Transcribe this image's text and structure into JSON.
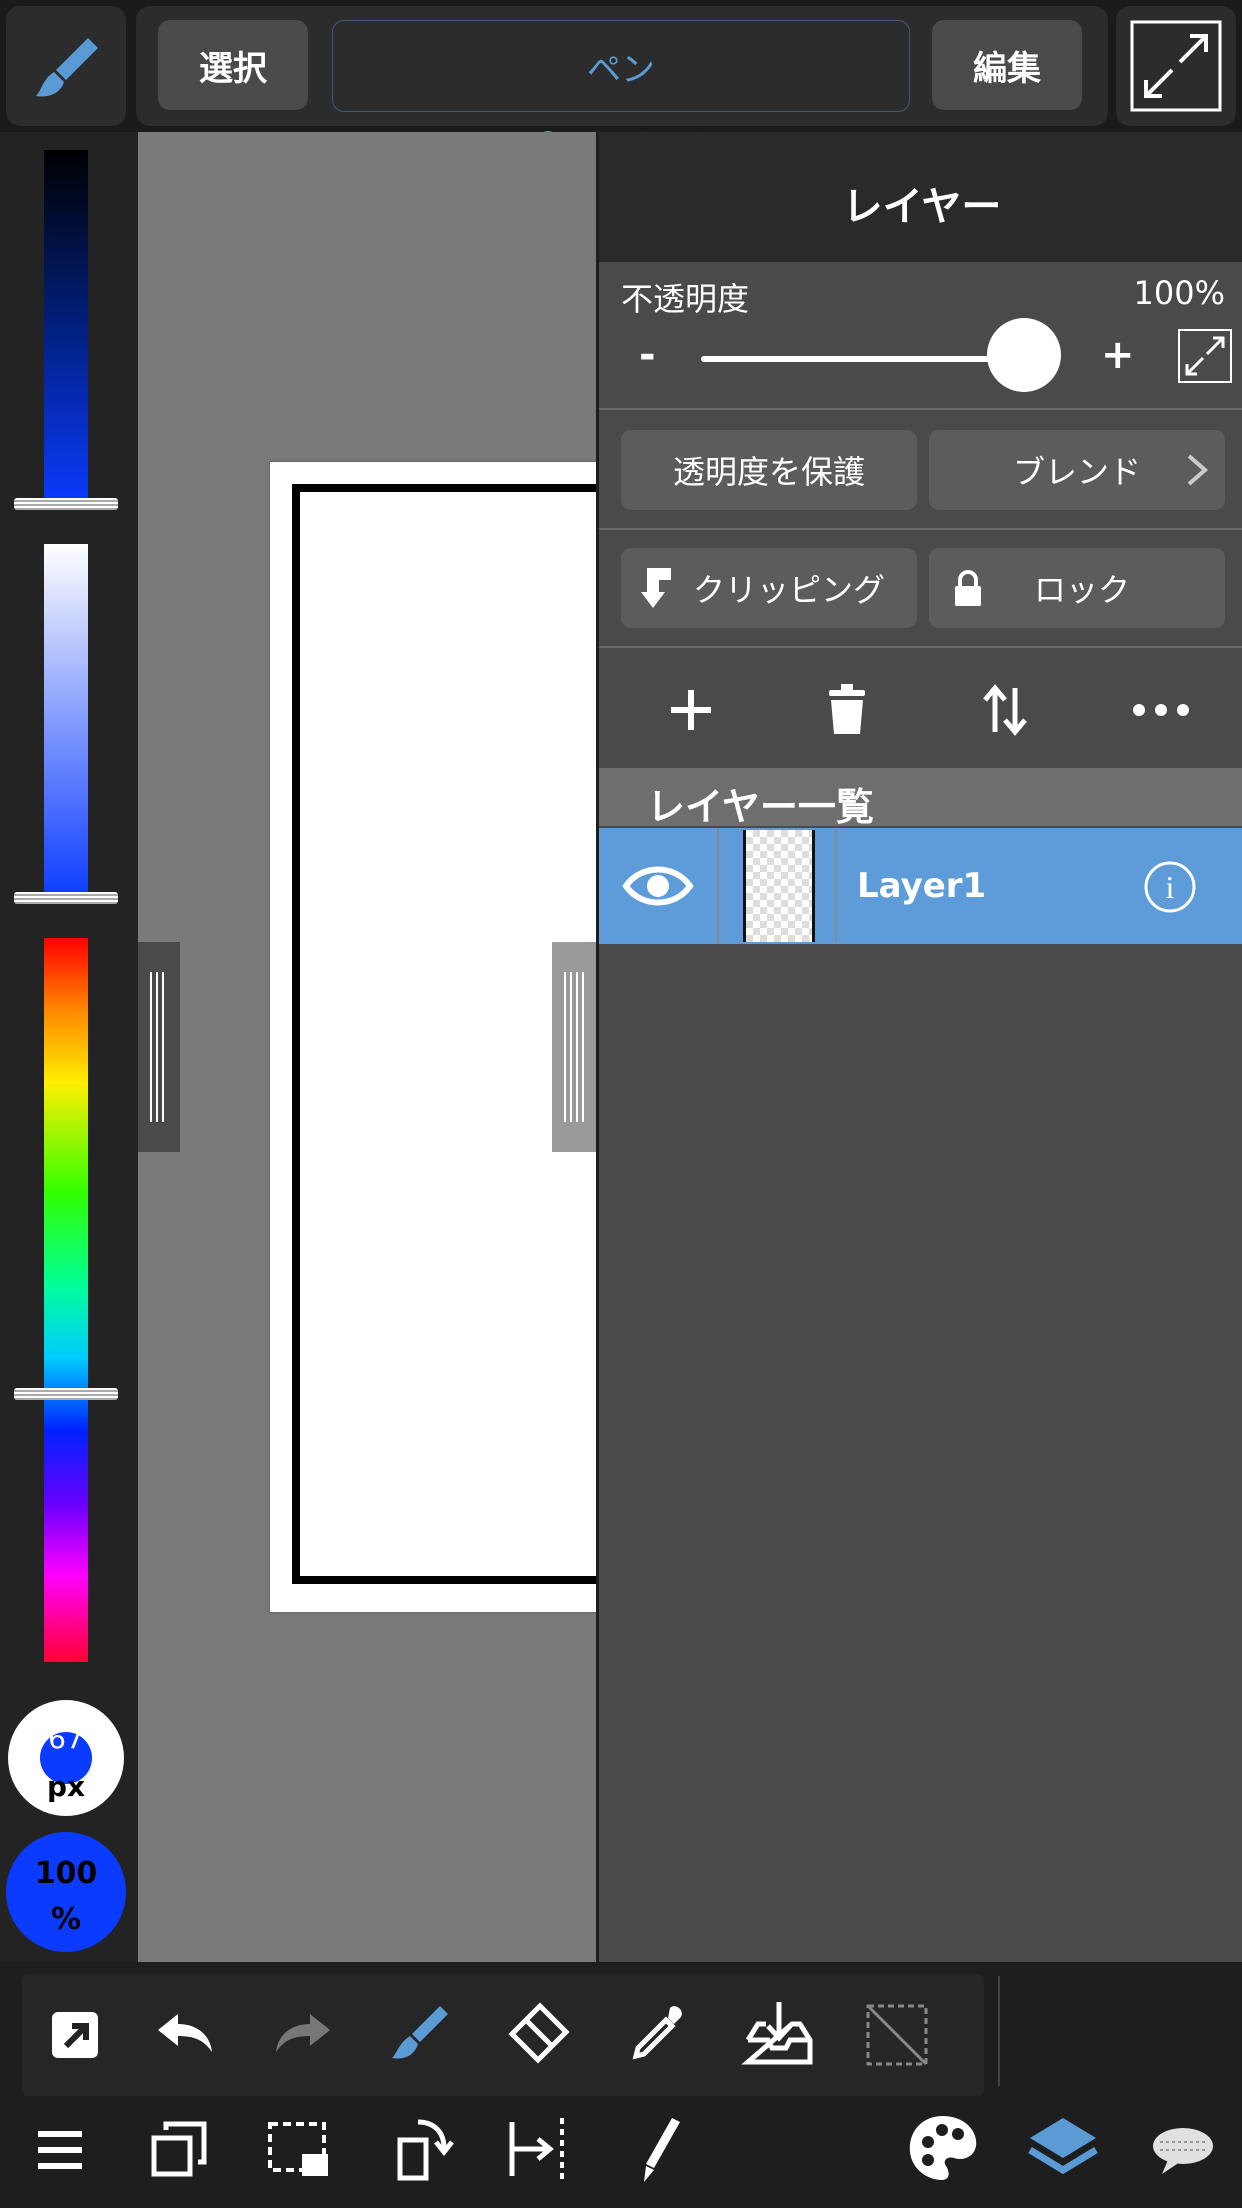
{
  "topbar": {
    "select_label": "選択",
    "tool_label": "ペン",
    "edit_label": "編集"
  },
  "left": {
    "brush_size_value": "67",
    "brush_size_unit": "px",
    "opacity_value": "100",
    "opacity_unit": "%"
  },
  "layer_panel": {
    "title": "レイヤー",
    "opacity_label": "不透明度",
    "opacity_value": "100%",
    "opacity_level": 1.0,
    "minus_label": "-",
    "plus_label": "+",
    "protect_alpha_label": "透明度を保護",
    "blend_label": "ブレンド",
    "clipping_label": "クリッピング",
    "lock_label": "ロック",
    "list_header": "レイヤー一覧",
    "layers": [
      {
        "name": "Layer1",
        "visible": true,
        "selected": true
      }
    ]
  },
  "colors": {
    "accent": "#5b9bd5",
    "selected_row": "#5d9cd8",
    "current_color": "#0a3bff"
  }
}
